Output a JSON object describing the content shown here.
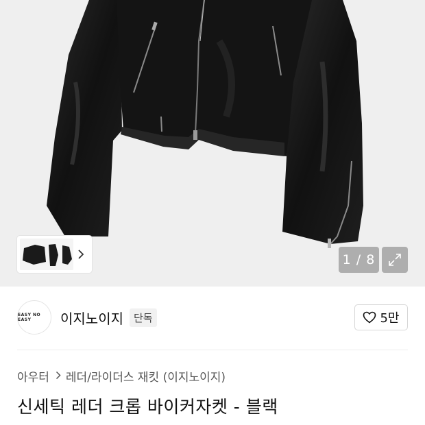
{
  "gallery": {
    "counter": "1 / 8",
    "thumbnail_alt": "jacket-thumbnails"
  },
  "brand": {
    "logo_line1": "EASY NO EASY",
    "logo_line2": "",
    "name": "이지노이지",
    "badge": "단독"
  },
  "like": {
    "count": "5만"
  },
  "breadcrumb": {
    "category": "아우터",
    "subcategory": "레더/라이더스 재킷 (이지노이지)"
  },
  "product": {
    "title": "신세틱 레더 크롭 바이커자켓 - 블랙"
  },
  "colors": {
    "background": "#efefef",
    "jacket": "#151515"
  },
  "icons": {
    "chevron": "chevron-right-icon",
    "expand": "expand-icon",
    "heart": "heart-outline-icon"
  }
}
